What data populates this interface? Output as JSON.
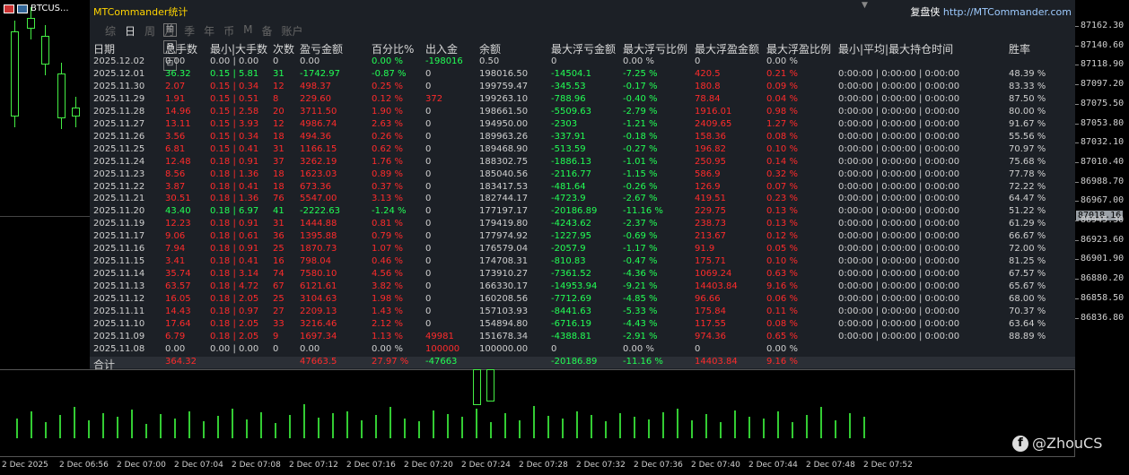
{
  "symbol": "BTCUS...",
  "panel": {
    "title": "MTCommander统计",
    "brand": "复盘侠",
    "url": "http://MTCommander.com",
    "tabs": [
      "综",
      "日",
      "周",
      "月",
      "季",
      "年",
      "币",
      "M",
      "备",
      "账户"
    ],
    "active_tab": 1,
    "side_buttons": [
      "拍",
      "⊠",
      "⊡"
    ]
  },
  "headers": [
    "日期",
    "总手数",
    "最小|大手数",
    "次数",
    "盈亏金额",
    "百分比%",
    "出入金",
    "余额",
    "最大浮亏金额",
    "最大浮亏比例",
    "最大浮盈金额",
    "最大浮盈比例",
    "最小|平均|最大持仓时间",
    "胜率"
  ],
  "rows": [
    {
      "c": [
        "2025.12.02",
        "0.00",
        "0.00 | 0.00",
        "0",
        "0.00",
        "0.00 %",
        "-198016",
        "0.50",
        "0",
        "0.00 %",
        "0",
        "0.00 %",
        "",
        ""
      ],
      "k": [
        "w",
        "w",
        "w",
        "w",
        "w",
        "g",
        "g",
        "w",
        "w",
        "w",
        "w",
        "w",
        "w",
        "w"
      ]
    },
    {
      "c": [
        "2025.12.01",
        "36.32",
        "0.15 | 5.81",
        "31",
        "-1742.97",
        "-0.87 %",
        "0",
        "198016.50",
        "-14504.1",
        "-7.25 %",
        "420.5",
        "0.21 %",
        "0:00:00 | 0:00:00 | 0:00:00",
        "48.39 %"
      ],
      "k": [
        "w",
        "g",
        "g",
        "g",
        "g",
        "g",
        "w",
        "w",
        "g",
        "g",
        "r",
        "r",
        "w",
        "w"
      ]
    },
    {
      "c": [
        "2025.11.30",
        "2.07",
        "0.15 | 0.34",
        "12",
        "498.37",
        "0.25 %",
        "0",
        "199759.47",
        "-345.53",
        "-0.17 %",
        "180.8",
        "0.09 %",
        "0:00:00 | 0:00:00 | 0:00:00",
        "83.33 %"
      ],
      "k": [
        "w",
        "r",
        "r",
        "r",
        "r",
        "r",
        "w",
        "w",
        "g",
        "g",
        "r",
        "r",
        "w",
        "w"
      ]
    },
    {
      "c": [
        "2025.11.29",
        "1.91",
        "0.15 | 0.51",
        "8",
        "229.60",
        "0.12 %",
        "372",
        "199263.10",
        "-788.96",
        "-0.40 %",
        "78.84",
        "0.04 %",
        "0:00:00 | 0:00:00 | 0:00:00",
        "87.50 %"
      ],
      "k": [
        "w",
        "r",
        "r",
        "r",
        "r",
        "r",
        "r",
        "w",
        "g",
        "g",
        "r",
        "r",
        "w",
        "w"
      ]
    },
    {
      "c": [
        "2025.11.28",
        "14.96",
        "0.15 | 2.58",
        "20",
        "3711.50",
        "1.90 %",
        "0",
        "198661.50",
        "-5509.63",
        "-2.79 %",
        "1916.01",
        "0.98 %",
        "0:00:00 | 0:00:00 | 0:00:00",
        "80.00 %"
      ],
      "k": [
        "w",
        "r",
        "r",
        "r",
        "r",
        "r",
        "w",
        "w",
        "g",
        "g",
        "r",
        "r",
        "w",
        "w"
      ]
    },
    {
      "c": [
        "2025.11.27",
        "13.11",
        "0.15 | 3.93",
        "12",
        "4986.74",
        "2.63 %",
        "0",
        "194950.00",
        "-2303",
        "-1.21 %",
        "2409.65",
        "1.27 %",
        "0:00:00 | 0:00:00 | 0:00:00",
        "91.67 %"
      ],
      "k": [
        "w",
        "r",
        "r",
        "r",
        "r",
        "r",
        "w",
        "w",
        "g",
        "g",
        "r",
        "r",
        "w",
        "w"
      ]
    },
    {
      "c": [
        "2025.11.26",
        "3.56",
        "0.15 | 0.34",
        "18",
        "494.36",
        "0.26 %",
        "0",
        "189963.26",
        "-337.91",
        "-0.18 %",
        "158.36",
        "0.08 %",
        "0:00:00 | 0:00:00 | 0:00:00",
        "55.56 %"
      ],
      "k": [
        "w",
        "r",
        "r",
        "r",
        "r",
        "r",
        "w",
        "w",
        "g",
        "g",
        "r",
        "r",
        "w",
        "w"
      ]
    },
    {
      "c": [
        "2025.11.25",
        "6.81",
        "0.15 | 0.41",
        "31",
        "1166.15",
        "0.62 %",
        "0",
        "189468.90",
        "-513.59",
        "-0.27 %",
        "196.82",
        "0.10 %",
        "0:00:00 | 0:00:00 | 0:00:00",
        "70.97 %"
      ],
      "k": [
        "w",
        "r",
        "r",
        "r",
        "r",
        "r",
        "w",
        "w",
        "g",
        "g",
        "r",
        "r",
        "w",
        "w"
      ]
    },
    {
      "c": [
        "2025.11.24",
        "12.48",
        "0.18 | 0.91",
        "37",
        "3262.19",
        "1.76 %",
        "0",
        "188302.75",
        "-1886.13",
        "-1.01 %",
        "250.95",
        "0.14 %",
        "0:00:00 | 0:00:00 | 0:00:00",
        "75.68 %"
      ],
      "k": [
        "w",
        "r",
        "r",
        "r",
        "r",
        "r",
        "w",
        "w",
        "g",
        "g",
        "r",
        "r",
        "w",
        "w"
      ]
    },
    {
      "c": [
        "2025.11.23",
        "8.56",
        "0.18 | 1.36",
        "18",
        "1623.03",
        "0.89 %",
        "0",
        "185040.56",
        "-2116.77",
        "-1.15 %",
        "586.9",
        "0.32 %",
        "0:00:00 | 0:00:00 | 0:00:00",
        "77.78 %"
      ],
      "k": [
        "w",
        "r",
        "r",
        "r",
        "r",
        "r",
        "w",
        "w",
        "g",
        "g",
        "r",
        "r",
        "w",
        "w"
      ]
    },
    {
      "c": [
        "2025.11.22",
        "3.87",
        "0.18 | 0.41",
        "18",
        "673.36",
        "0.37 %",
        "0",
        "183417.53",
        "-481.64",
        "-0.26 %",
        "126.9",
        "0.07 %",
        "0:00:00 | 0:00:00 | 0:00:00",
        "72.22 %"
      ],
      "k": [
        "w",
        "r",
        "r",
        "r",
        "r",
        "r",
        "w",
        "w",
        "g",
        "g",
        "r",
        "r",
        "w",
        "w"
      ]
    },
    {
      "c": [
        "2025.11.21",
        "30.51",
        "0.18 | 1.36",
        "76",
        "5547.00",
        "3.13 %",
        "0",
        "182744.17",
        "-4723.9",
        "-2.67 %",
        "419.51",
        "0.23 %",
        "0:00:00 | 0:00:00 | 0:00:00",
        "64.47 %"
      ],
      "k": [
        "w",
        "r",
        "r",
        "r",
        "r",
        "r",
        "w",
        "w",
        "g",
        "g",
        "r",
        "r",
        "w",
        "w"
      ]
    },
    {
      "c": [
        "2025.11.20",
        "43.40",
        "0.18 | 6.97",
        "41",
        "-2222.63",
        "-1.24 %",
        "0",
        "177197.17",
        "-20186.89",
        "-11.16 %",
        "229.75",
        "0.13 %",
        "0:00:00 | 0:00:00 | 0:00:00",
        "51.22 %"
      ],
      "k": [
        "w",
        "g",
        "g",
        "g",
        "g",
        "g",
        "w",
        "w",
        "g",
        "g",
        "r",
        "r",
        "w",
        "w"
      ]
    },
    {
      "c": [
        "2025.11.19",
        "12.23",
        "0.18 | 0.91",
        "31",
        "1444.88",
        "0.81 %",
        "0",
        "179419.80",
        "-4243.62",
        "-2.37 %",
        "238.73",
        "0.13 %",
        "0:00:00 | 0:00:00 | 0:00:00",
        "61.29 %"
      ],
      "k": [
        "w",
        "r",
        "r",
        "r",
        "r",
        "r",
        "w",
        "w",
        "g",
        "g",
        "r",
        "r",
        "w",
        "w"
      ]
    },
    {
      "c": [
        "2025.11.17",
        "9.06",
        "0.18 | 0.61",
        "36",
        "1395.88",
        "0.79 %",
        "0",
        "177974.92",
        "-1227.95",
        "-0.69 %",
        "213.67",
        "0.12 %",
        "0:00:00 | 0:00:00 | 0:00:00",
        "66.67 %"
      ],
      "k": [
        "w",
        "r",
        "r",
        "r",
        "r",
        "r",
        "w",
        "w",
        "g",
        "g",
        "r",
        "r",
        "w",
        "w"
      ]
    },
    {
      "c": [
        "2025.11.16",
        "7.94",
        "0.18 | 0.91",
        "25",
        "1870.73",
        "1.07 %",
        "0",
        "176579.04",
        "-2057.9",
        "-1.17 %",
        "91.9",
        "0.05 %",
        "0:00:00 | 0:00:00 | 0:00:00",
        "72.00 %"
      ],
      "k": [
        "w",
        "r",
        "r",
        "r",
        "r",
        "r",
        "w",
        "w",
        "g",
        "g",
        "r",
        "r",
        "w",
        "w"
      ]
    },
    {
      "c": [
        "2025.11.15",
        "3.41",
        "0.18 | 0.41",
        "16",
        "798.04",
        "0.46 %",
        "0",
        "174708.31",
        "-810.83",
        "-0.47 %",
        "175.71",
        "0.10 %",
        "0:00:00 | 0:00:00 | 0:00:00",
        "81.25 %"
      ],
      "k": [
        "w",
        "r",
        "r",
        "r",
        "r",
        "r",
        "w",
        "w",
        "g",
        "g",
        "r",
        "r",
        "w",
        "w"
      ]
    },
    {
      "c": [
        "2025.11.14",
        "35.74",
        "0.18 | 3.14",
        "74",
        "7580.10",
        "4.56 %",
        "0",
        "173910.27",
        "-7361.52",
        "-4.36 %",
        "1069.24",
        "0.63 %",
        "0:00:00 | 0:00:00 | 0:00:00",
        "67.57 %"
      ],
      "k": [
        "w",
        "r",
        "r",
        "r",
        "r",
        "r",
        "w",
        "w",
        "g",
        "g",
        "r",
        "r",
        "w",
        "w"
      ]
    },
    {
      "c": [
        "2025.11.13",
        "63.57",
        "0.18 | 4.72",
        "67",
        "6121.61",
        "3.82 %",
        "0",
        "166330.17",
        "-14953.94",
        "-9.21 %",
        "14403.84",
        "9.16 %",
        "0:00:00 | 0:00:00 | 0:00:00",
        "65.67 %"
      ],
      "k": [
        "w",
        "r",
        "r",
        "r",
        "r",
        "r",
        "w",
        "w",
        "g",
        "g",
        "r",
        "r",
        "w",
        "w"
      ]
    },
    {
      "c": [
        "2025.11.12",
        "16.05",
        "0.18 | 2.05",
        "25",
        "3104.63",
        "1.98 %",
        "0",
        "160208.56",
        "-7712.69",
        "-4.85 %",
        "96.66",
        "0.06 %",
        "0:00:00 | 0:00:00 | 0:00:00",
        "68.00 %"
      ],
      "k": [
        "w",
        "r",
        "r",
        "r",
        "r",
        "r",
        "w",
        "w",
        "g",
        "g",
        "r",
        "r",
        "w",
        "w"
      ]
    },
    {
      "c": [
        "2025.11.11",
        "14.43",
        "0.18 | 0.97",
        "27",
        "2209.13",
        "1.43 %",
        "0",
        "157103.93",
        "-8441.63",
        "-5.33 %",
        "175.84",
        "0.11 %",
        "0:00:00 | 0:00:00 | 0:00:00",
        "70.37 %"
      ],
      "k": [
        "w",
        "r",
        "r",
        "r",
        "r",
        "r",
        "w",
        "w",
        "g",
        "g",
        "r",
        "r",
        "w",
        "w"
      ]
    },
    {
      "c": [
        "2025.11.10",
        "17.64",
        "0.18 | 2.05",
        "33",
        "3216.46",
        "2.12 %",
        "0",
        "154894.80",
        "-6716.19",
        "-4.43 %",
        "117.55",
        "0.08 %",
        "0:00:00 | 0:00:00 | 0:00:00",
        "63.64 %"
      ],
      "k": [
        "w",
        "r",
        "r",
        "r",
        "r",
        "r",
        "w",
        "w",
        "g",
        "g",
        "r",
        "r",
        "w",
        "w"
      ]
    },
    {
      "c": [
        "2025.11.09",
        "6.79",
        "0.18 | 2.05",
        "9",
        "1697.34",
        "1.13 %",
        "49981",
        "151678.34",
        "-4388.81",
        "-2.91 %",
        "974.36",
        "0.65 %",
        "0:00:00 | 0:00:00 | 0:00:00",
        "88.89 %"
      ],
      "k": [
        "w",
        "r",
        "r",
        "r",
        "r",
        "r",
        "r",
        "w",
        "g",
        "g",
        "r",
        "r",
        "w",
        "w"
      ]
    },
    {
      "c": [
        "2025.11.08",
        "0.00",
        "0.00 | 0.00",
        "0",
        "0.00",
        "0.00 %",
        "100000",
        "100000.00",
        "0",
        "0.00 %",
        "0",
        "0.00 %",
        "",
        ""
      ],
      "k": [
        "w",
        "w",
        "w",
        "w",
        "w",
        "w",
        "r",
        "w",
        "w",
        "w",
        "w",
        "w",
        "w",
        "w"
      ]
    }
  ],
  "total": {
    "c": [
      "合计",
      "364.32",
      "",
      "",
      "47663.5",
      "27.97 %",
      "-47663",
      "",
      "-20186.89",
      "-11.16 %",
      "14403.84",
      "9.16 %",
      "",
      ""
    ],
    "k": [
      "w",
      "r",
      "w",
      "w",
      "r",
      "r",
      "g",
      "w",
      "g",
      "g",
      "r",
      "r",
      "w",
      "w"
    ]
  },
  "price_axis": [
    "87162.30",
    "87140.60",
    "87118.90",
    "87097.20",
    "87075.50",
    "87053.80",
    "87032.10",
    "87010.40",
    "86988.70",
    "86967.00",
    "86945.30",
    "86923.60",
    "86901.90",
    "86880.20",
    "86858.50",
    "86836.80"
  ],
  "current_price": "87018.16",
  "time_axis": [
    "2 Dec 2025",
    "2 Dec 06:56",
    "2 Dec 07:00",
    "2 Dec 07:04",
    "2 Dec 07:08",
    "2 Dec 07:12",
    "2 Dec 07:16",
    "2 Dec 07:20",
    "2 Dec 07:24",
    "2 Dec 07:28",
    "2 Dec 07:32",
    "2 Dec 07:36",
    "2 Dec 07:40",
    "2 Dec 07:44",
    "2 Dec 07:48",
    "2 Dec 07:52"
  ],
  "watermark": "@ZhouCS",
  "colors": {
    "red": "#ff2b2b",
    "green": "#22ff55",
    "panel_bg": "#1c2026",
    "title": "#ffd400"
  }
}
